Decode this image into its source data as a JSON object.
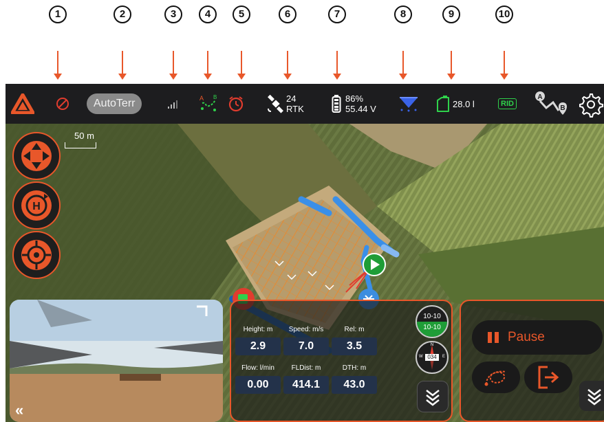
{
  "callouts": [
    "1",
    "2",
    "3",
    "4",
    "5",
    "6",
    "7",
    "8",
    "9",
    "10"
  ],
  "topbar": {
    "mode_label": "AutoTerr",
    "satellites": "24",
    "fix_type": "RTK",
    "battery_percent": "86%",
    "battery_voltage": "55.44 V",
    "tank_level": "28.0 l",
    "rid_label": "RID",
    "waypoint_a": "A",
    "waypoint_b": "B"
  },
  "map": {
    "scale_label": "50 m"
  },
  "telemetry": {
    "items": [
      {
        "label": "Height: m",
        "value": "2.9"
      },
      {
        "label": "Speed: m/s",
        "value": "7.0"
      },
      {
        "label": "Rel: m",
        "value": "3.5"
      },
      {
        "label": "Flow: l/min",
        "value": "0.00"
      },
      {
        "label": "FLDist: m",
        "value": "414.1"
      },
      {
        "label": "DTH: m",
        "value": "43.0"
      }
    ],
    "attitude_top": "10-10",
    "attitude_bottom": "10-10",
    "heading": "034",
    "compass_n": "N",
    "compass_e": "E",
    "compass_w": "W"
  },
  "actions": {
    "pause_label": "Pause"
  },
  "video": {
    "collapse_label": "«"
  },
  "colors": {
    "accent": "#e8572a",
    "ok_green": "#2fd24b",
    "topbar_bg": "#1d1d1f",
    "route_blue": "#3a8fe8"
  }
}
